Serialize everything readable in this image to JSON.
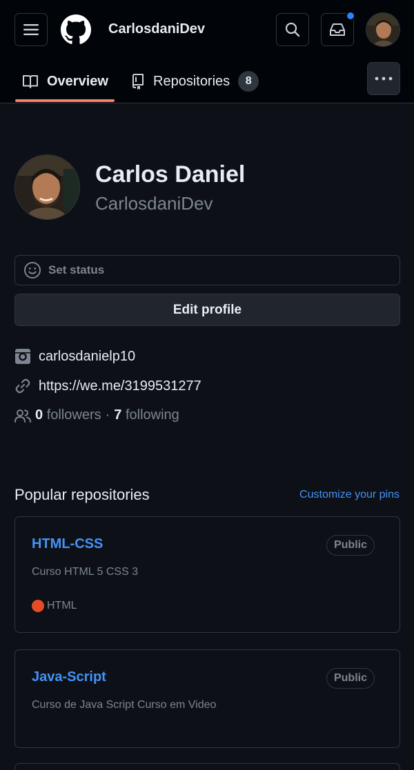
{
  "header": {
    "username": "CarlosdaniDev",
    "notification_dot_color": "#2f81f7",
    "icons": [
      "hamburger-icon",
      "github-logo",
      "search-icon",
      "inbox-icon",
      "avatar"
    ]
  },
  "tabs": [
    {
      "label": "Overview",
      "icon": "book-icon",
      "selected": true
    },
    {
      "label": "Repositories",
      "icon": "repo-icon",
      "count": "8",
      "selected": false
    }
  ],
  "profile": {
    "full_name": "Carlos Daniel",
    "login": "CarlosdaniDev",
    "status_placeholder": "Set status",
    "edit_button": "Edit profile",
    "instagram": "carlosdanielp10",
    "website": "https://we.me/3199531277",
    "followers_count": "0",
    "followers_label": "followers",
    "separator": "·",
    "following_count": "7",
    "following_label": "following"
  },
  "popular": {
    "title": "Popular repositories",
    "customize_link": "Customize your pins",
    "repos": [
      {
        "name": "HTML-CSS",
        "visibility": "Public",
        "description": "Curso HTML 5 CSS 3",
        "language": "HTML",
        "language_color": "#e34c26"
      },
      {
        "name": "Java-Script",
        "visibility": "Public",
        "description": "Curso de Java Script Curso em Video"
      }
    ]
  },
  "colors": {
    "background": "#0d1117",
    "header_background": "#010409",
    "accent_link": "#4493f8",
    "tab_underline": "#f78166",
    "border": "#30363d"
  }
}
